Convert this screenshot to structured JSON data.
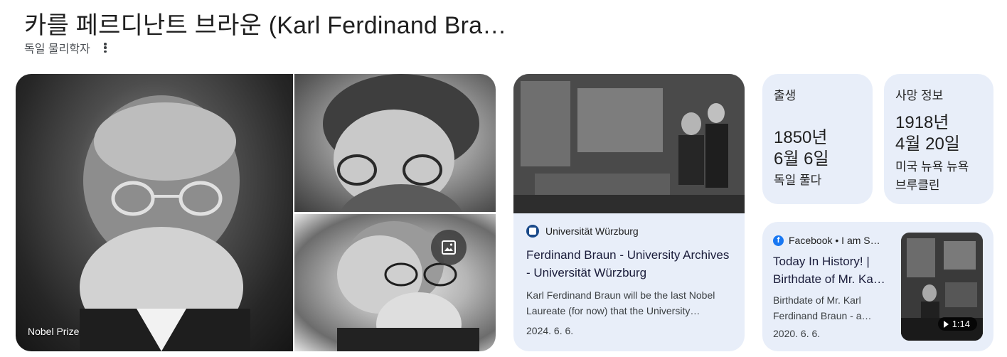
{
  "header": {
    "title": "카를 페르디난트 브라운 (Karl Ferdinand Bra…",
    "subtitle": "독일 물리학자",
    "more_icon": "more-vert-icon"
  },
  "photos": {
    "main_caption": "Nobel Prize",
    "image_search_icon": "image-icon"
  },
  "article": {
    "source": "Universität Würzburg",
    "title": "Ferdinand Braun - University Archives - Universität Würzburg",
    "snippet": "Karl Ferdinand Braun will be the last Nobel Laureate (for now) that the University…",
    "date": "2024. 6. 6."
  },
  "birth": {
    "label": "출생",
    "date_year": "1850년",
    "date_day": "6월 6일",
    "place": "독일 풀다"
  },
  "death": {
    "label": "사망 정보",
    "date_year": "1918년",
    "date_day": "4월 20일",
    "place_line1": "미국 뉴욕 뉴욕",
    "place_line2": "브루클린"
  },
  "video": {
    "source": "Facebook • I am S…",
    "title_line1": "Today In History! |",
    "title_line2": "Birthdate of Mr. Ka…",
    "snippet_line1": "Birthdate of Mr. Karl",
    "snippet_line2": "Ferdinand Braun - a…",
    "date": "2020. 6. 6.",
    "duration": "1:14"
  },
  "colors": {
    "card_bg": "#e8eef9",
    "facebook_blue": "#1877f2",
    "title_text": "#1f1f1f"
  }
}
